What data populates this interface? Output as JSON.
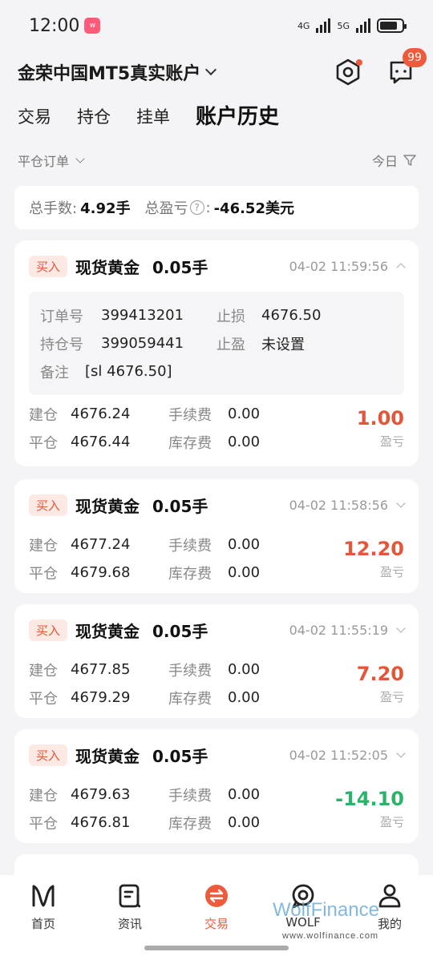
{
  "status_bar": {
    "time": "12:00",
    "net1": "4G",
    "net2": "5G",
    "app_badge": "Weibo"
  },
  "header": {
    "account_title": "金荣中国MT5真实账户",
    "message_badge": "99"
  },
  "tabs": [
    {
      "label": "交易"
    },
    {
      "label": "持仓"
    },
    {
      "label": "挂单"
    },
    {
      "label": "账户历史",
      "active": true
    }
  ],
  "filter": {
    "order_type": "平仓订单",
    "date_range": "今日"
  },
  "summary": {
    "total_lots_label": "总手数:",
    "total_lots_value": "4.92手",
    "total_pnl_label": "总盈亏",
    "total_pnl_help": "?",
    "total_pnl_colon": ":",
    "total_pnl_value": "-46.52美元"
  },
  "labels": {
    "buy": "买入",
    "order_no": "订单号",
    "position_no": "持仓号",
    "stop_loss": "止损",
    "take_profit": "止盈",
    "remark": "备注",
    "open": "建仓",
    "close": "平仓",
    "fee": "手续费",
    "swap": "库存费",
    "pnl": "盈亏"
  },
  "orders": [
    {
      "side": "买入",
      "symbol": "现货黄金",
      "lots": "0.05手",
      "time": "04-02 11:59:56",
      "expanded": true,
      "order_no": "399413201",
      "stop_loss": "4676.50",
      "position_no": "399059441",
      "take_profit": "未设置",
      "remark": "[sl 4676.50]",
      "open_price": "4676.24",
      "close_price": "4676.44",
      "fee": "0.00",
      "swap": "0.00",
      "pnl": "1.00"
    },
    {
      "side": "买入",
      "symbol": "现货黄金",
      "lots": "0.05手",
      "time": "04-02 11:58:56",
      "open_price": "4677.24",
      "close_price": "4679.68",
      "fee": "0.00",
      "swap": "0.00",
      "pnl": "12.20"
    },
    {
      "side": "买入",
      "symbol": "现货黄金",
      "lots": "0.05手",
      "time": "04-02 11:55:19",
      "open_price": "4677.85",
      "close_price": "4679.29",
      "fee": "0.00",
      "swap": "0.00",
      "pnl": "7.20"
    },
    {
      "side": "买入",
      "symbol": "现货黄金",
      "lots": "0.05手",
      "time": "04-02 11:52:05",
      "open_price": "4679.63",
      "close_price": "4676.81",
      "fee": "0.00",
      "swap": "0.00",
      "pnl": "-14.10"
    }
  ],
  "nav": [
    {
      "label": "首页",
      "icon": "home-logo-icon"
    },
    {
      "label": "资讯",
      "icon": "news-icon"
    },
    {
      "label": "交易",
      "icon": "trade-icon",
      "active": true
    },
    {
      "label": "WOLF",
      "icon": "wolf-icon"
    },
    {
      "label": "我的",
      "icon": "profile-icon"
    }
  ],
  "watermark": {
    "brand": "WolfFinance",
    "url": "www.wolfinance.com"
  },
  "colors": {
    "accent": "#ee5a3c",
    "profit": "#e2563a",
    "loss": "#2cb36a"
  }
}
